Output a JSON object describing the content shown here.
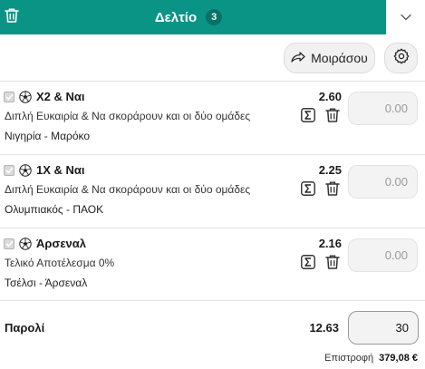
{
  "header": {
    "title": "Δελτίο",
    "count": "3",
    "colors": {
      "brand": "#0a9486"
    }
  },
  "toolbar": {
    "share_label": "Μοιράσου",
    "share_icon": "share-arrow-icon",
    "settings_icon": "gear-icon"
  },
  "bets": [
    {
      "selection": "Χ2 & Ναι",
      "market": "Διπλή Ευκαιρία & Να σκοράρουν και οι δύο ομάδες",
      "event": "Νιγηρία - Μαρόκο",
      "odds": "2.60",
      "stake_placeholder": "0.00"
    },
    {
      "selection": "1Χ & Ναι",
      "market": "Διπλή Ευκαιρία & Να σκοράρουν και οι δύο ομάδες",
      "event": "Ολυμπιακός - ΠΑΟΚ",
      "odds": "2.25",
      "stake_placeholder": "0.00"
    },
    {
      "selection": "Άρσεναλ",
      "market": "Τελικό Αποτέλεσμα 0%",
      "event": "Τσέλσι - Άρσεναλ",
      "odds": "2.16",
      "stake_placeholder": "0.00"
    }
  ],
  "totals": {
    "label": "Παρολί",
    "odds": "12.63",
    "stake": "30",
    "return_label": "Επιστροφή",
    "return_value": "379,08 €"
  }
}
